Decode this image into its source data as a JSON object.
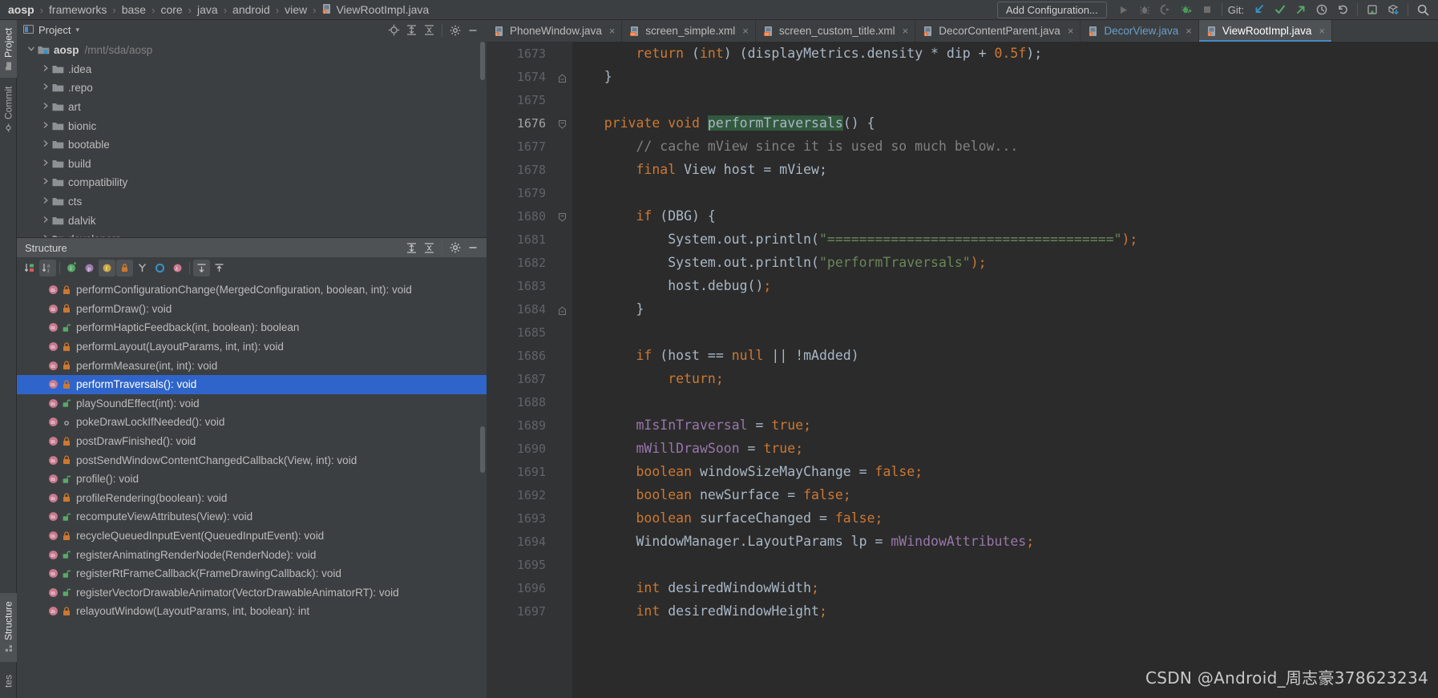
{
  "navbar": {
    "breadcrumb": [
      {
        "label": "aosp",
        "root": true
      },
      {
        "label": "frameworks"
      },
      {
        "label": "base"
      },
      {
        "label": "core"
      },
      {
        "label": "java"
      },
      {
        "label": "android"
      },
      {
        "label": "view"
      },
      {
        "label": "ViewRootImpl.java",
        "icon": "java-file-icon"
      }
    ],
    "separator": "›",
    "add_configuration": "Add Configuration...",
    "git_label": "Git:",
    "run_icon": "run-icon",
    "debug_icon": "debug-icon",
    "coverage_icon": "run-with-coverage-icon",
    "profile_icon": "profiler-icon",
    "stop_icon": "stop-icon",
    "git_update_icon": "git-update-project-icon",
    "git_commit_icon": "git-commit-icon",
    "git_push_icon": "git-push-icon",
    "git_history_icon": "git-history-icon",
    "git_rollback_icon": "git-rollback-icon",
    "search_everywhere_icon": "search-icon",
    "settings_icon": "settings-icon",
    "bookmark_icon": "bookmark-icon",
    "download_icon": "download-icon"
  },
  "left_tool_tabs": [
    {
      "label": "Project",
      "icon": "folder-icon",
      "active": true
    },
    {
      "label": "Commit",
      "icon": "commit-icon",
      "active": false
    }
  ],
  "left_tool_tabs_bottom": [
    {
      "label": "Structure",
      "icon": "structure-icon",
      "active": true
    },
    {
      "label": "tes",
      "icon": "favorites-icon",
      "active": false
    }
  ],
  "project_panel": {
    "title": "Project",
    "chevron": "▾",
    "window_icon": "project-window-icon",
    "locate_icon": "locate-icon",
    "expand_icon": "expand-all-icon",
    "collapse_icon": "collapse-all-icon",
    "settings_icon": "gear-icon",
    "minimize_icon": "minimize-icon",
    "tree": [
      {
        "label": "aosp",
        "path": "/mnt/sda/aosp",
        "expanded": true,
        "depth": 0,
        "root": true,
        "icon": "module-icon"
      },
      {
        "label": ".idea",
        "expanded": false,
        "depth": 1,
        "icon": "folder-icon"
      },
      {
        "label": ".repo",
        "expanded": false,
        "depth": 1,
        "icon": "folder-icon"
      },
      {
        "label": "art",
        "expanded": false,
        "depth": 1,
        "icon": "folder-icon"
      },
      {
        "label": "bionic",
        "expanded": false,
        "depth": 1,
        "icon": "folder-icon"
      },
      {
        "label": "bootable",
        "expanded": false,
        "depth": 1,
        "icon": "folder-icon"
      },
      {
        "label": "build",
        "expanded": false,
        "depth": 1,
        "icon": "folder-icon"
      },
      {
        "label": "compatibility",
        "expanded": false,
        "depth": 1,
        "icon": "folder-icon"
      },
      {
        "label": "cts",
        "expanded": false,
        "depth": 1,
        "icon": "folder-icon"
      },
      {
        "label": "dalvik",
        "expanded": false,
        "depth": 1,
        "icon": "folder-icon"
      },
      {
        "label": "developers",
        "expanded": false,
        "depth": 1,
        "icon": "folder-icon"
      }
    ]
  },
  "structure_panel": {
    "title": "Structure",
    "expand_icon": "expand-all-icon",
    "collapse_icon": "collapse-all-icon",
    "settings_icon": "gear-icon",
    "minimize_icon": "minimize-icon",
    "toolbar": [
      {
        "name": "sort-by-visibility-icon",
        "active": false
      },
      {
        "name": "sort-alphabetically-icon",
        "active": true
      },
      {
        "name": "show-inherited-icon",
        "active": false
      },
      {
        "name": "show-properties-icon",
        "active": false
      },
      {
        "name": "show-fields-icon",
        "active": true
      },
      {
        "name": "show-non-public-icon",
        "active": true
      },
      {
        "name": "show-anonymous-icon",
        "active": false
      },
      {
        "name": "group-by-interface-icon",
        "active": false
      },
      {
        "name": "show-lambdas-icon",
        "active": false
      },
      {
        "name": "expand-all-icon",
        "active": true
      },
      {
        "name": "collapse-all-icon",
        "active": false
      }
    ],
    "members": [
      {
        "label": "performConfigurationChange(MergedConfiguration, boolean, int): void",
        "visibility": "private",
        "selected": false
      },
      {
        "label": "performDraw(): void",
        "visibility": "private",
        "selected": false
      },
      {
        "label": "performHapticFeedback(int, boolean): boolean",
        "visibility": "public",
        "selected": false
      },
      {
        "label": "performLayout(LayoutParams, int, int): void",
        "visibility": "private",
        "selected": false
      },
      {
        "label": "performMeasure(int, int): void",
        "visibility": "private",
        "selected": false
      },
      {
        "label": "performTraversals(): void",
        "visibility": "private",
        "selected": true
      },
      {
        "label": "playSoundEffect(int): void",
        "visibility": "public",
        "selected": false
      },
      {
        "label": "pokeDrawLockIfNeeded(): void",
        "visibility": "package",
        "selected": false
      },
      {
        "label": "postDrawFinished(): void",
        "visibility": "private",
        "selected": false
      },
      {
        "label": "postSendWindowContentChangedCallback(View, int): void",
        "visibility": "private",
        "selected": false
      },
      {
        "label": "profile(): void",
        "visibility": "public",
        "selected": false
      },
      {
        "label": "profileRendering(boolean): void",
        "visibility": "private",
        "selected": false
      },
      {
        "label": "recomputeViewAttributes(View): void",
        "visibility": "public",
        "selected": false
      },
      {
        "label": "recycleQueuedInputEvent(QueuedInputEvent): void",
        "visibility": "private",
        "selected": false
      },
      {
        "label": "registerAnimatingRenderNode(RenderNode): void",
        "visibility": "public",
        "selected": false
      },
      {
        "label": "registerRtFrameCallback(FrameDrawingCallback): void",
        "visibility": "public",
        "selected": false
      },
      {
        "label": "registerVectorDrawableAnimator(VectorDrawableAnimatorRT): void",
        "visibility": "public",
        "selected": false
      },
      {
        "label": "relayoutWindow(LayoutParams, int, boolean): int",
        "visibility": "private",
        "selected": false
      }
    ]
  },
  "editor": {
    "tabs": [
      {
        "label": "PhoneWindow.java",
        "icon": "java-file-icon",
        "active": false,
        "modified": false,
        "close": "×"
      },
      {
        "label": "screen_simple.xml",
        "icon": "xml-file-icon",
        "active": false,
        "modified": false,
        "close": "×"
      },
      {
        "label": "screen_custom_title.xml",
        "icon": "xml-file-icon",
        "active": false,
        "modified": false,
        "close": "×"
      },
      {
        "label": "DecorContentParent.java",
        "icon": "java-file-icon",
        "active": false,
        "modified": false,
        "close": "×"
      },
      {
        "label": "DecorView.java",
        "icon": "java-file-icon",
        "active": false,
        "modified": true,
        "close": "×"
      },
      {
        "label": "ViewRootImpl.java",
        "icon": "java-file-icon",
        "active": true,
        "modified": false,
        "close": "×"
      }
    ],
    "first_line_number": 1673,
    "current_line": 1676,
    "lines": [
      {
        "num": 1673,
        "fold": "",
        "tokens": [
          {
            "t": "        ",
            "c": "n"
          },
          {
            "t": "return",
            "c": "k"
          },
          {
            "t": " (",
            "c": "n"
          },
          {
            "t": "int",
            "c": "k"
          },
          {
            "t": ") (displayMetrics.density * dip + ",
            "c": "n"
          },
          {
            "t": "0.5f",
            "c": "k"
          },
          {
            "t": ");",
            "c": "n"
          }
        ]
      },
      {
        "num": 1674,
        "fold": "end",
        "tokens": [
          {
            "t": "    }",
            "c": "n"
          }
        ]
      },
      {
        "num": 1675,
        "fold": "",
        "tokens": [
          {
            "t": "",
            "c": "n"
          }
        ]
      },
      {
        "num": 1676,
        "fold": "start",
        "tokens": [
          {
            "t": "    ",
            "c": "n"
          },
          {
            "t": "private",
            "c": "k"
          },
          {
            "t": " ",
            "c": "n"
          },
          {
            "t": "void",
            "c": "k"
          },
          {
            "t": " ",
            "c": "n"
          },
          {
            "t": "performTraversals",
            "c": "n",
            "hl": true
          },
          {
            "t": "() {",
            "c": "n"
          }
        ]
      },
      {
        "num": 1677,
        "fold": "",
        "tokens": [
          {
            "t": "        ",
            "c": "n"
          },
          {
            "t": "// cache mView since it is used so much below...",
            "c": "cm"
          }
        ]
      },
      {
        "num": 1678,
        "fold": "",
        "tokens": [
          {
            "t": "        ",
            "c": "n"
          },
          {
            "t": "final",
            "c": "k"
          },
          {
            "t": " View host = mView;",
            "c": "n"
          }
        ]
      },
      {
        "num": 1679,
        "fold": "",
        "tokens": [
          {
            "t": "",
            "c": "n"
          }
        ]
      },
      {
        "num": 1680,
        "fold": "start",
        "tokens": [
          {
            "t": "        ",
            "c": "n"
          },
          {
            "t": "if",
            "c": "k"
          },
          {
            "t": " (DBG) {",
            "c": "n"
          }
        ]
      },
      {
        "num": 1681,
        "fold": "",
        "tokens": [
          {
            "t": "            System.out.println(",
            "c": "n"
          },
          {
            "t": "\"====================================\"",
            "c": "s"
          },
          {
            "t": ");",
            "c": "k"
          }
        ]
      },
      {
        "num": 1682,
        "fold": "",
        "tokens": [
          {
            "t": "            System.out.println(",
            "c": "n"
          },
          {
            "t": "\"performTraversals\"",
            "c": "s"
          },
          {
            "t": ");",
            "c": "k"
          }
        ]
      },
      {
        "num": 1683,
        "fold": "",
        "tokens": [
          {
            "t": "            host.debug()",
            "c": "n"
          },
          {
            "t": ";",
            "c": "k"
          }
        ]
      },
      {
        "num": 1684,
        "fold": "end",
        "tokens": [
          {
            "t": "        }",
            "c": "n"
          }
        ]
      },
      {
        "num": 1685,
        "fold": "",
        "tokens": [
          {
            "t": "",
            "c": "n"
          }
        ]
      },
      {
        "num": 1686,
        "fold": "",
        "tokens": [
          {
            "t": "        ",
            "c": "n"
          },
          {
            "t": "if",
            "c": "k"
          },
          {
            "t": " (host == ",
            "c": "n"
          },
          {
            "t": "null",
            "c": "k"
          },
          {
            "t": " || !mAdded)",
            "c": "n"
          }
        ]
      },
      {
        "num": 1687,
        "fold": "",
        "tokens": [
          {
            "t": "            ",
            "c": "n"
          },
          {
            "t": "return",
            "c": "k"
          },
          {
            "t": ";",
            "c": "k"
          }
        ]
      },
      {
        "num": 1688,
        "fold": "",
        "tokens": [
          {
            "t": "",
            "c": "n"
          }
        ]
      },
      {
        "num": 1689,
        "fold": "",
        "tokens": [
          {
            "t": "        ",
            "c": "n"
          },
          {
            "t": "mIsInTraversal",
            "c": "f"
          },
          {
            "t": " = ",
            "c": "n"
          },
          {
            "t": "true",
            "c": "k"
          },
          {
            "t": ";",
            "c": "k"
          }
        ]
      },
      {
        "num": 1690,
        "fold": "",
        "tokens": [
          {
            "t": "        ",
            "c": "n"
          },
          {
            "t": "mWillDrawSoon",
            "c": "f"
          },
          {
            "t": " = ",
            "c": "n"
          },
          {
            "t": "true",
            "c": "k"
          },
          {
            "t": ";",
            "c": "k"
          }
        ]
      },
      {
        "num": 1691,
        "fold": "",
        "tokens": [
          {
            "t": "        ",
            "c": "n"
          },
          {
            "t": "boolean",
            "c": "k"
          },
          {
            "t": " windowSizeMayChange = ",
            "c": "n"
          },
          {
            "t": "false",
            "c": "k"
          },
          {
            "t": ";",
            "c": "k"
          }
        ]
      },
      {
        "num": 1692,
        "fold": "",
        "tokens": [
          {
            "t": "        ",
            "c": "n"
          },
          {
            "t": "boolean",
            "c": "k"
          },
          {
            "t": " newSurface = ",
            "c": "n"
          },
          {
            "t": "false",
            "c": "k"
          },
          {
            "t": ";",
            "c": "k"
          }
        ]
      },
      {
        "num": 1693,
        "fold": "",
        "tokens": [
          {
            "t": "        ",
            "c": "n"
          },
          {
            "t": "boolean",
            "c": "k"
          },
          {
            "t": " surfaceChanged = ",
            "c": "n"
          },
          {
            "t": "false",
            "c": "k"
          },
          {
            "t": ";",
            "c": "k"
          }
        ]
      },
      {
        "num": 1694,
        "fold": "",
        "tokens": [
          {
            "t": "        WindowManager.LayoutParams lp = ",
            "c": "n"
          },
          {
            "t": "mWindowAttributes",
            "c": "f"
          },
          {
            "t": ";",
            "c": "k"
          }
        ]
      },
      {
        "num": 1695,
        "fold": "",
        "tokens": [
          {
            "t": "",
            "c": "n"
          }
        ]
      },
      {
        "num": 1696,
        "fold": "",
        "tokens": [
          {
            "t": "        ",
            "c": "n"
          },
          {
            "t": "int",
            "c": "k"
          },
          {
            "t": " desiredWindowWidth",
            "c": "n"
          },
          {
            "t": ";",
            "c": "k"
          }
        ]
      },
      {
        "num": 1697,
        "fold": "",
        "tokens": [
          {
            "t": "        ",
            "c": "n"
          },
          {
            "t": "int",
            "c": "k"
          },
          {
            "t": " desiredWindowHeight",
            "c": "n"
          },
          {
            "t": ";",
            "c": "k"
          }
        ]
      }
    ]
  },
  "watermark": "CSDN @Android_周志豪378623234",
  "colors": {
    "background": "#3c3f41",
    "editor_background": "#2b2b2b",
    "gutter": "#313335",
    "selection": "#2f65ca",
    "keyword": "#cc7832",
    "string": "#6a8759",
    "comment": "#808080",
    "field": "#9876aa",
    "text": "#a9b7c6",
    "tab_underline": "#4a88c7",
    "highlight": "#32593d"
  }
}
